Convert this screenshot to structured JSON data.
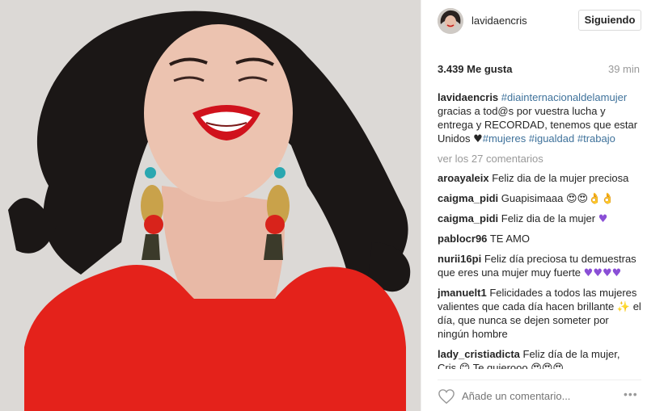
{
  "post": {
    "username": "lavidaencris",
    "follow_label": "Siguiendo",
    "likes": "3.439 Me gusta",
    "time": "39 min"
  },
  "caption": {
    "username": "lavidaencris",
    "tag1": "#diainternacionaldelamujer",
    "text1": "gracias a tod@s por vuestra lucha y entrega y RECORDAD, tenemos que estar Unidos",
    "tag2": "#mujeres",
    "tag3": "#igualdad",
    "tag4": "#trabajo"
  },
  "view_more": "ver los 27 comentarios",
  "comments": [
    {
      "user": "aroayaleix",
      "text": "Feliz dia de la mujer preciosa"
    },
    {
      "user": "caigma_pidi",
      "text": "Guapisimaaa"
    },
    {
      "user": "caigma_pidi",
      "text": "Feliz dia de la mujer"
    },
    {
      "user": "pablocr96",
      "text": "TE AMO"
    },
    {
      "user": "nurii16pi",
      "text": "Feliz día preciosa tu demuestras que eres una mujer muy fuerte"
    },
    {
      "user": "jmanuelt1",
      "text1": "Felicidades a todos las mujeres valientes que cada día hacen brillante",
      "text2": "el día, que nunca se dejen someter por ningún hombre"
    },
    {
      "user": "lady_cristiadicta",
      "text1": "Feliz día de la mujer, Cris",
      "text2": "Te quierooo"
    }
  ],
  "add_comment_placeholder": "Añade un comentario...",
  "more_options": "•••",
  "colors": {
    "link": "#3f729b",
    "dress": "#e4221b",
    "heart_purple": "#8a4fd6"
  }
}
